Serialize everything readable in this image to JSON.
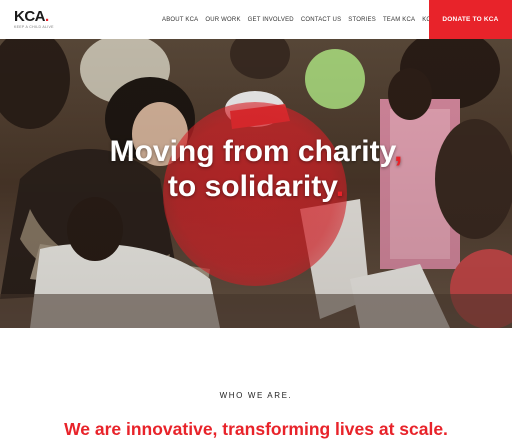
{
  "header": {
    "logo": {
      "word": "KCA",
      "dot": ".",
      "tagline": "KEEP A CHILD ALIVE"
    },
    "nav": [
      {
        "label": "ABOUT KCA"
      },
      {
        "label": "OUR WORK"
      },
      {
        "label": "GET INVOLVED"
      },
      {
        "label": "CONTACT US"
      },
      {
        "label": "STORIES"
      },
      {
        "label": "TEAM KCA"
      },
      {
        "label": "KCA SHOP"
      }
    ],
    "donate_label": "DONATE TO KCA"
  },
  "hero": {
    "line1": "Moving from charity",
    "line1_mark": ",",
    "line2": "to solidarity",
    "line2_mark": "."
  },
  "who": {
    "heading": "WHO WE ARE."
  },
  "mission": {
    "tagline": "We are innovative, transforming lives at scale."
  },
  "colors": {
    "accent": "#e8232a",
    "text": "#222222",
    "background": "#ffffff"
  }
}
